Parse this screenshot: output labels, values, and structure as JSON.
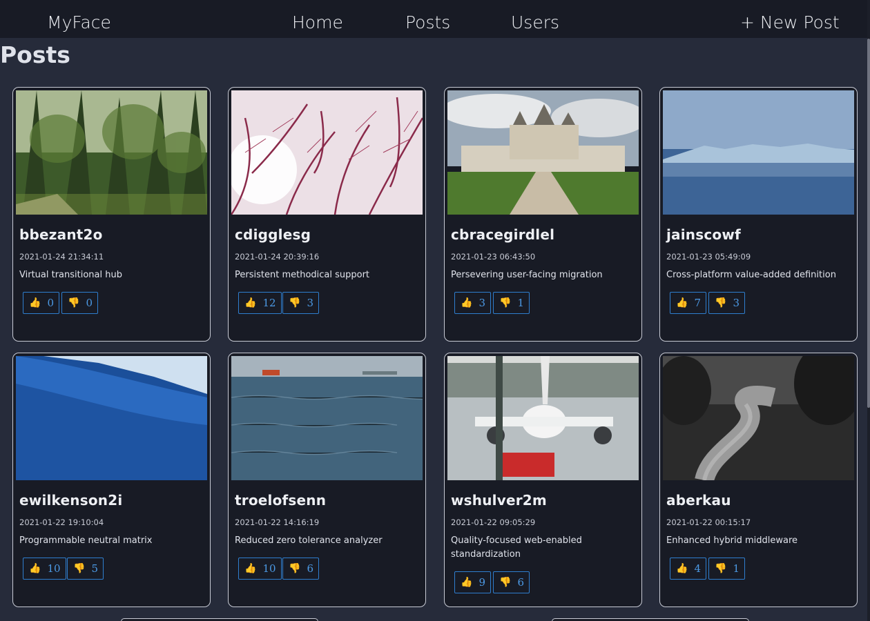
{
  "nav": {
    "brand": "MyFace",
    "home": "Home",
    "posts": "Posts",
    "users": "Users",
    "new_post": "+ New Post"
  },
  "page": {
    "title": "Posts"
  },
  "posts": [
    {
      "user": "bbezant2o",
      "date": "2021-01-24 21:34:11",
      "text": "Virtual transitional hub",
      "likes": "0",
      "dislikes": "0",
      "image": "forest"
    },
    {
      "user": "cdigglesg",
      "date": "2021-01-24 20:39:16",
      "text": "Persistent methodical support",
      "likes": "12",
      "dislikes": "3",
      "image": "branches"
    },
    {
      "user": "cbracegirdlel",
      "date": "2021-01-23 06:43:50",
      "text": "Persevering user-facing migration",
      "likes": "3",
      "dislikes": "1",
      "image": "castle"
    },
    {
      "user": "jainscowf",
      "date": "2021-01-23 05:49:09",
      "text": "Cross-platform value-added definition",
      "likes": "7",
      "dislikes": "3",
      "image": "glacier"
    },
    {
      "user": "ewilkenson2i",
      "date": "2021-01-22 19:10:04",
      "text": "Programmable neutral matrix",
      "likes": "10",
      "dislikes": "5",
      "image": "wave"
    },
    {
      "user": "troelofsenn",
      "date": "2021-01-22 14:16:19",
      "text": "Reduced zero tolerance analyzer",
      "likes": "10",
      "dislikes": "6",
      "image": "sea"
    },
    {
      "user": "wshulver2m",
      "date": "2021-01-22 09:05:29",
      "text": "Quality-focused web-enabled standardization",
      "likes": "9",
      "dislikes": "6",
      "image": "airplane"
    },
    {
      "user": "aberkau",
      "date": "2021-01-22 00:15:17",
      "text": "Enhanced hybrid middleware",
      "likes": "4",
      "dislikes": "1",
      "image": "road"
    }
  ],
  "icons": {
    "like": "thumbs-up-icon",
    "dislike": "thumbs-down-icon"
  },
  "colors": {
    "nav_bg": "#181b25",
    "page_bg": "#262b3a",
    "accent": "#2f7fd0"
  }
}
